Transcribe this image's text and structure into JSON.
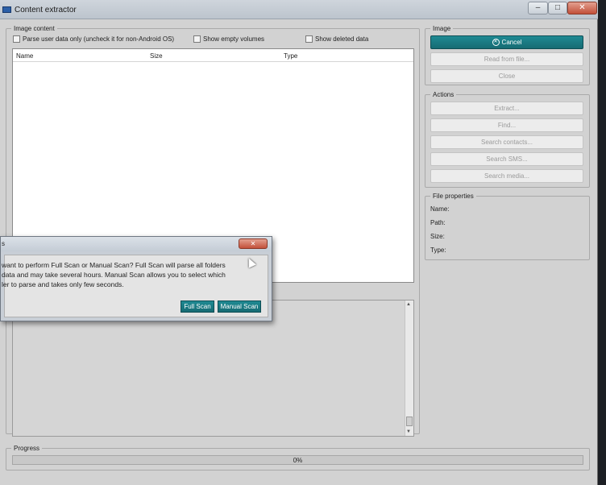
{
  "window": {
    "title": "Content extractor",
    "controls": {
      "minimize": "–",
      "maximize": "□",
      "close": "✕"
    }
  },
  "image_content": {
    "legend": "Image content",
    "checkboxes": [
      {
        "label": "Parse user data only (uncheck it for non-Android OS)",
        "checked": false
      },
      {
        "label": "Show empty volumes",
        "checked": false
      },
      {
        "label": "Show deleted data",
        "checked": false
      }
    ],
    "columns": [
      "Name",
      "Size",
      "Type"
    ]
  },
  "image_group": {
    "legend": "Image",
    "cancel_label": "Cancel",
    "read_from_file_label": "Read from file...",
    "close_label": "Close"
  },
  "actions_group": {
    "legend": "Actions",
    "buttons": [
      "Extract...",
      "Find...",
      "Search contacts...",
      "Search SMS...",
      "Search media..."
    ]
  },
  "file_properties": {
    "legend": "File properties",
    "labels": [
      "Name:",
      "Path:",
      "Size:",
      "Type:"
    ]
  },
  "progress": {
    "legend": "Progress",
    "value_text": "0%",
    "value": 0
  },
  "dialog": {
    "title_glyph": "s",
    "message": " want to perform Full Scan or Manual Scan? Full Scan will parse all folders\n data and may take several hours. Manual Scan allows you to select which\nler to parse and takes only few seconds.",
    "full_scan_label": "Full Scan",
    "manual_scan_label": "Manual Scan",
    "close_glyph": "✕"
  },
  "colors": {
    "accent": "#1a7a82",
    "window_bg": "#d2d2d2",
    "close_red": "#c2503a"
  }
}
